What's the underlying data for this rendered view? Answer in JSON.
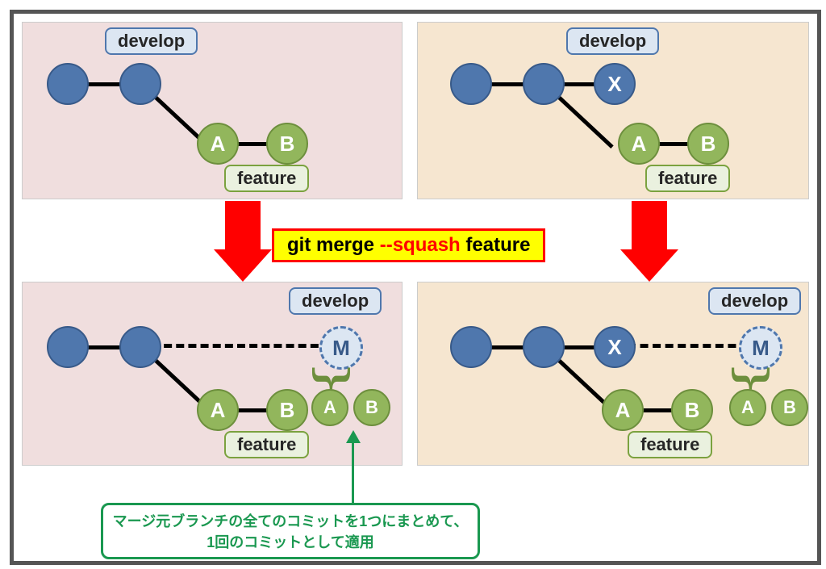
{
  "labels": {
    "develop": "develop",
    "feature": "feature"
  },
  "commits": {
    "A": "A",
    "B": "B",
    "X": "X",
    "M": "M"
  },
  "command": {
    "prefix": "git merge ",
    "flag": "--squash",
    "suffix": " feature"
  },
  "note": {
    "line1": "マージ元ブランチの全てのコミットを1つにまとめて、",
    "line2": "1回のコミットとして適用"
  },
  "chart_data": {
    "type": "diagram",
    "title": "git merge --squash feature",
    "panels": [
      {
        "id": "top-left",
        "branches": {
          "develop": [
            "c1",
            "c2"
          ],
          "feature": [
            "A",
            "B"
          ]
        },
        "feature_base": "c2"
      },
      {
        "id": "top-right",
        "branches": {
          "develop": [
            "c1",
            "c2",
            "X"
          ],
          "feature": [
            "A",
            "B"
          ]
        },
        "feature_base": "c2"
      },
      {
        "id": "bottom-left",
        "branches": {
          "develop": [
            "c1",
            "c2",
            "M"
          ],
          "feature": [
            "A",
            "B"
          ]
        },
        "feature_base": "c2",
        "squashed_into_M": [
          "A",
          "B"
        ]
      },
      {
        "id": "bottom-right",
        "branches": {
          "develop": [
            "c1",
            "c2",
            "X",
            "M"
          ],
          "feature": [
            "A",
            "B"
          ]
        },
        "feature_base": "c2",
        "squashed_into_M": [
          "A",
          "B"
        ]
      }
    ],
    "transition": "git merge --squash feature",
    "annotation": "マージ元ブランチの全てのコミットを1つにまとめて、1回のコミットとして適用"
  }
}
